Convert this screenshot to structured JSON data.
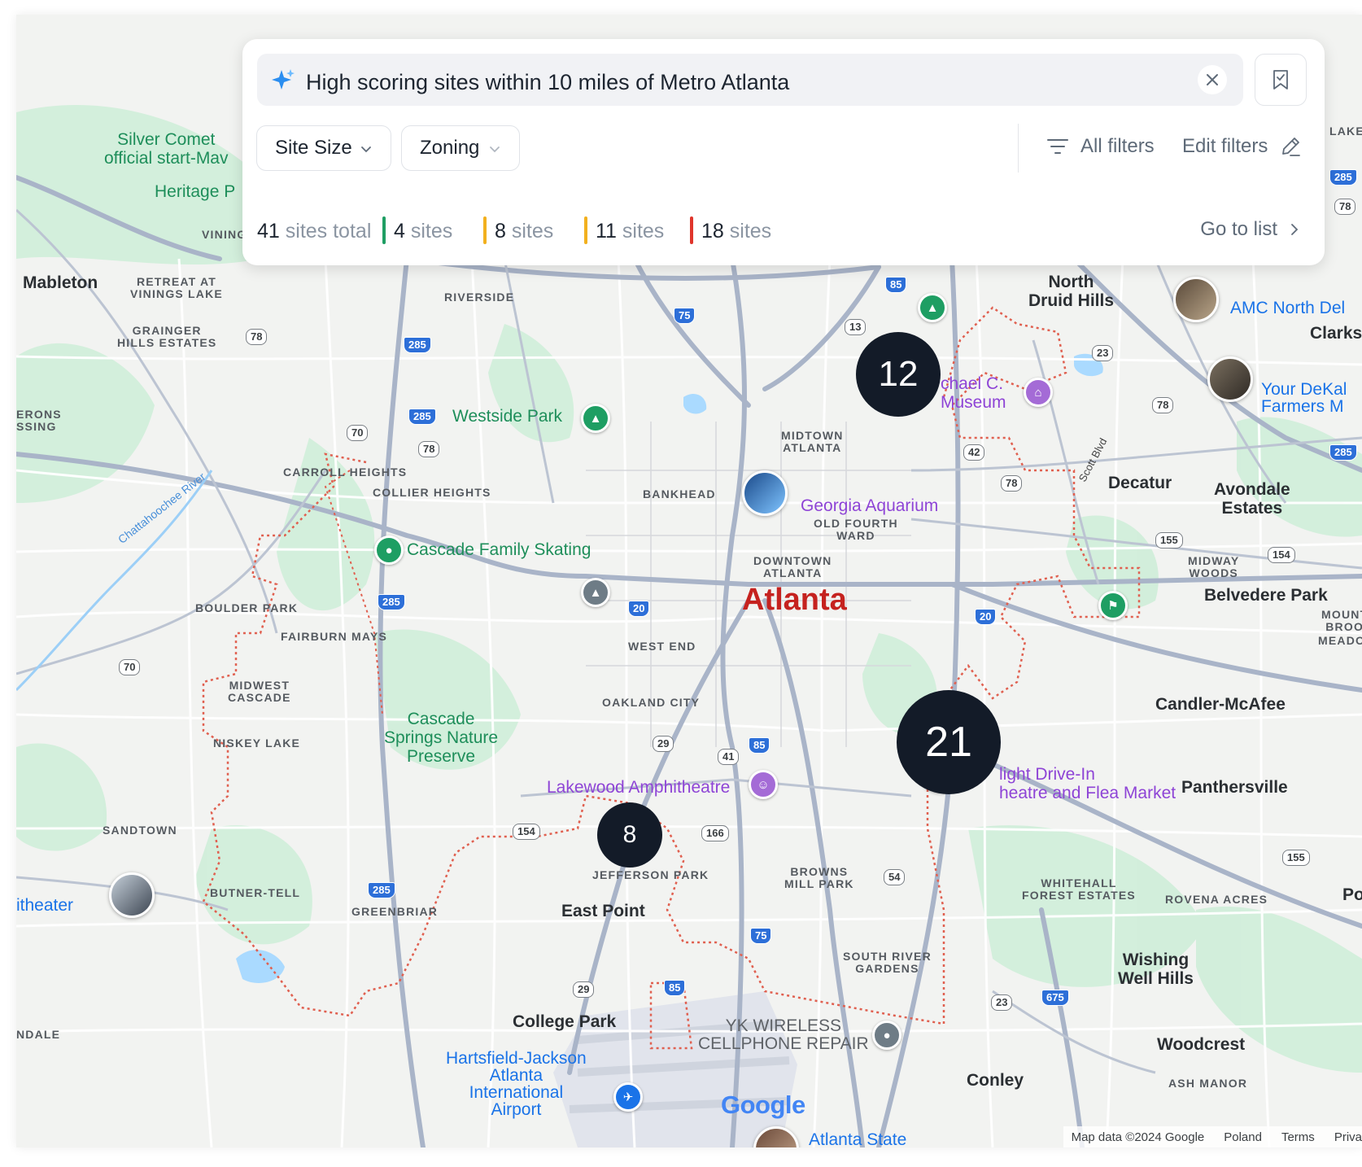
{
  "search": {
    "query": "High scoring sites within 10 miles of Metro Atlanta"
  },
  "filters": {
    "chips": [
      {
        "label": "Site Size"
      },
      {
        "label": "Zoning"
      }
    ],
    "all_filters": "All filters",
    "edit_filters": "Edit filters"
  },
  "stats": {
    "total_count": "41",
    "total_label": "sites total",
    "groups": [
      {
        "count": "4",
        "label": "sites",
        "color": "#1e9e63"
      },
      {
        "count": "8",
        "label": "sites",
        "color": "#f2b01e"
      },
      {
        "count": "11",
        "label": "sites",
        "color": "#f2b01e"
      },
      {
        "count": "18",
        "label": "sites",
        "color": "#e0352b"
      }
    ],
    "go_to_list": "Go to list"
  },
  "clusters": [
    "12",
    "21",
    "8"
  ],
  "map": {
    "city": "Atlanta",
    "towns": [
      "Mableton",
      "North\nDruid Hills",
      "Decatur",
      "Avondale\nEstates",
      "Belvedere Park",
      "Candler-McAfee",
      "Panthersville",
      "East Point",
      "College Park",
      "Wishing\nWell Hills",
      "Woodcrest",
      "Conley",
      "Clarks",
      "Po"
    ],
    "neighborhoods": [
      "RETREAT AT\nVININGS LAKE",
      "GRAINGER\nHILLS ESTATES",
      "VINING",
      "ERONS\nSSING",
      "RIVERSIDE",
      "CARROLL HEIGHTS",
      "COLLIER HEIGHTS",
      "BANKHEAD",
      "MIDTOWN\nATLANTA",
      "OLD FOURTH\nWARD",
      "DOWNTOWN\nATLANTA",
      "BOULDER PARK",
      "FAIRBURN MAYS",
      "WEST END",
      "MIDWEST\nCASCADE",
      "OAKLAND CITY",
      "NISKEY LAKE",
      "SANDTOWN",
      "BUTNER-TELL",
      "GREENBRIAR",
      "JEFFERSON PARK",
      "BROWNS\nMILL PARK",
      "SOUTH RIVER\nGARDENS",
      "WHITEHALL\nFOREST ESTATES",
      "ROVENA ACRES",
      "ASH MANOR",
      "MIDWAY\nWOODS",
      "MOUNT\nBROO",
      "MEADOW",
      "LAKE",
      "NDALE"
    ],
    "parks": [
      "Silver Comet\nofficial start-Mav",
      "Heritage P",
      "Westside Park",
      "Cascade Family Skating",
      "Cascade\nSprings Nature\nPreserve"
    ],
    "pois": [
      "Georgia Aquarium",
      "chael C.\nMuseum",
      "Lakewood Amphitheatre",
      "light Drive-In\nheatre and Flea Market",
      "AMC North Del",
      "Your DeKal\nFarmers M",
      "itheater",
      "Atlanta State"
    ],
    "airport": "Hartsfield-Jackson\nAtlanta\nInternational\nAirport",
    "business": "YK WIRELESS\nCELLPHONE REPAIR",
    "river": "Chattahoochee River",
    "street": "Scott Blvd",
    "highways": [
      "41",
      "85",
      "75",
      "285",
      "285",
      "285",
      "285",
      "285",
      "285",
      "20",
      "20",
      "85",
      "75",
      "85",
      "675"
    ],
    "routes": [
      "13",
      "78",
      "78",
      "70",
      "78",
      "23",
      "78",
      "42",
      "78",
      "155",
      "154",
      "70",
      "29",
      "41",
      "166",
      "154",
      "54",
      "155",
      "29",
      "23",
      "29"
    ]
  },
  "google_logo": "Google",
  "attribution": {
    "map_data": "Map data ©2024 Google",
    "region": "Poland",
    "terms": "Terms",
    "privacy": "Priva"
  },
  "colors": {
    "cluster": "#131b28",
    "accent_blue": "#1a73e8",
    "city_red": "#c5221f",
    "park_green": "#1e8e5a",
    "poi_purple": "#8e44d6"
  }
}
